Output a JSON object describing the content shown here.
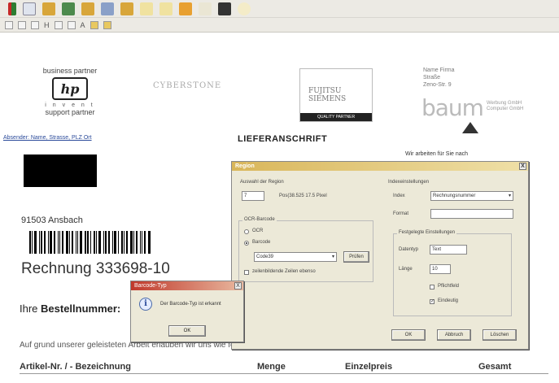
{
  "toolbar": {
    "icons": [
      "app-icon",
      "new-doc-icon",
      "open-folder-icon",
      "save-icon",
      "open-icon",
      "print-icon",
      "folder-icon",
      "undo-icon",
      "copy-icon",
      "paste-icon",
      "blank-icon",
      "disk-icon",
      "help-icon"
    ],
    "small_row_text": [
      "H",
      "A"
    ]
  },
  "document": {
    "hp_top": "business partner",
    "hp_logo_text": "hp",
    "hp_invent": "i n v e n t",
    "hp_bottom": "support partner",
    "partner_logo_text": "CYBERSTONE",
    "fujitsu_text": "FUJITSU SIEMENS",
    "fujitsu_bar_text": "QUALITY PARTNER",
    "address_right": [
      "Name Firma",
      "Straße",
      "Zeno-Str. 9"
    ],
    "baum_text": "baum",
    "baum_sub": [
      "Werbung GmbH",
      "Computer GmbH"
    ],
    "wir_arbeiten": "Wir arbeiten für Sie nach",
    "sender_line": "Absender: Name, Strasse, PLZ Ort",
    "lieferanschrift": "LIEFERANSCHRIFT",
    "city": "91503 Ansbach",
    "rechnung": "Rechnung 333698-10",
    "bestell_prefix": "Ihre ",
    "bestell_bold": "Bestellnummer:",
    "aufgrund": "Auf grund unserer geleisteten Arbeit erlauben wir uns wie folgt in Rechnung zu stellen:",
    "columns": [
      "Artikel-Nr. / - Bezeichnung",
      "Menge",
      "Einzelpreis",
      "Gesamt"
    ]
  },
  "dialog": {
    "title": "Region",
    "close_label": "X",
    "auswahl_label": "Auswahl der Region",
    "region_value": "7",
    "region_desc": "Pos(38.525  17.5 Pixel",
    "ocr_group": "OCR-Barcode",
    "ocr_option": "OCR",
    "barcode_option": "Barcode",
    "barcode_select": "Code39",
    "pruefen_button": "Prüfen",
    "checkbox_label": "zeilenbildende Zeilen ebenso",
    "index_group": "Indexeinstellungen",
    "index_label": "Index",
    "index_value": "Rechnungsnummer",
    "format_label": "Format",
    "format_value": "",
    "festgelegt_group": "Festgelegte Einstellungen",
    "datentyp_label": "Datentyp",
    "datentyp_value": "Text",
    "laenge_label": "Länge",
    "laenge_value": "10",
    "pflichtfeld_label": "Pflichtfeld",
    "eindeutig_label": "Eindeutig",
    "ok_button": "OK",
    "abbruch_button": "Abbruch",
    "loeschen_button": "Löschen"
  },
  "popup": {
    "title": "Barcode-Typ",
    "close_label": "X",
    "message": "Der Barcode-Typ ist erkannt",
    "ok_button": "OK"
  },
  "colors": {
    "toolbar_bg": "#eceae4",
    "dialog_bg": "#ece9d8",
    "link": "#2a4a9a"
  }
}
